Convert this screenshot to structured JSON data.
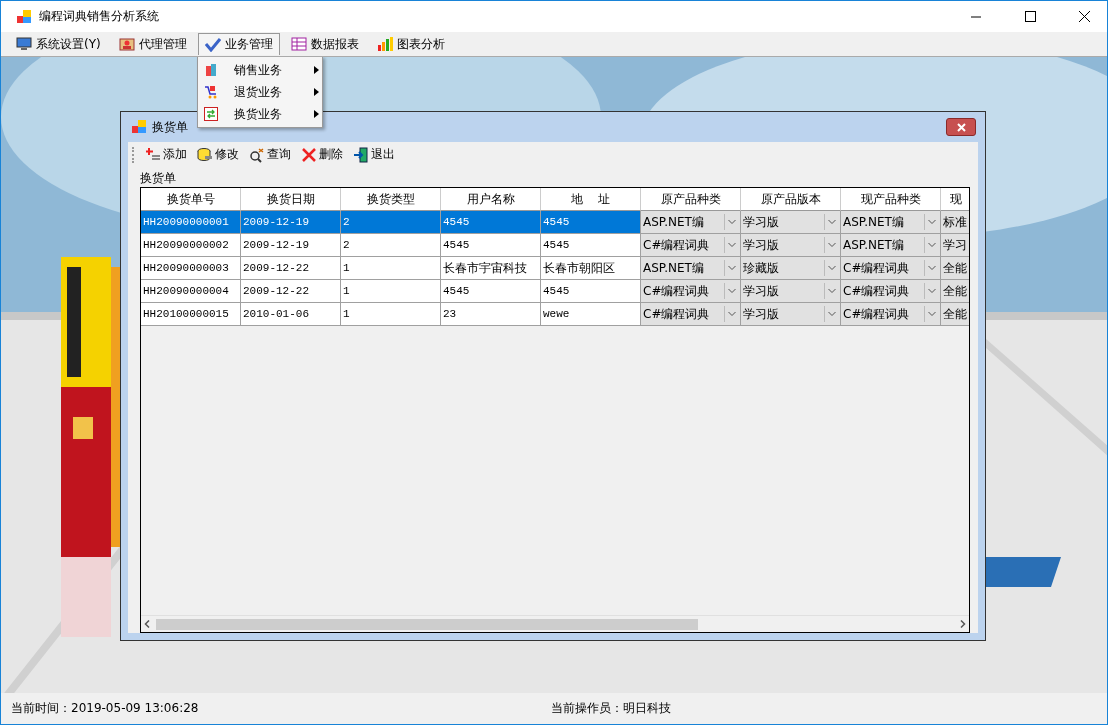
{
  "window": {
    "title": "编程词典销售分析系统"
  },
  "menu": [
    {
      "label": "系统设置(Y)",
      "selected": false
    },
    {
      "label": "代理管理",
      "selected": false
    },
    {
      "label": "业务管理",
      "selected": true
    },
    {
      "label": "数据报表",
      "selected": false
    },
    {
      "label": "图表分析",
      "selected": false
    }
  ],
  "submenu": [
    {
      "label": "销售业务"
    },
    {
      "label": "退货业务"
    },
    {
      "label": "换货业务"
    }
  ],
  "child_window": {
    "title": "换货单",
    "toolbar": [
      {
        "label": "添加"
      },
      {
        "label": "修改"
      },
      {
        "label": "查询"
      },
      {
        "label": "删除"
      },
      {
        "label": "退出"
      }
    ],
    "group_label": "换货单",
    "table": {
      "columns": [
        {
          "label": "换货单号",
          "kind": "text"
        },
        {
          "label": "换货日期",
          "kind": "text"
        },
        {
          "label": "换货类型",
          "kind": "text"
        },
        {
          "label": "用户名称",
          "kind": "text"
        },
        {
          "label": "地    址",
          "kind": "text"
        },
        {
          "label": "原产品种类",
          "kind": "combo"
        },
        {
          "label": "原产品版本",
          "kind": "combo"
        },
        {
          "label": "现产品种类",
          "kind": "combo"
        },
        {
          "label": "现",
          "kind": "combo"
        }
      ],
      "rows": [
        {
          "selected": true,
          "cells": [
            "HH20090000001",
            "2009-12-19",
            "2",
            "4545",
            "4545",
            "ASP.NET编",
            "学习版",
            "ASP.NET编",
            "标准"
          ]
        },
        {
          "selected": false,
          "cells": [
            "HH20090000002",
            "2009-12-19",
            "2",
            "4545",
            "4545",
            "C#编程词典",
            "学习版",
            "ASP.NET编",
            "学习"
          ]
        },
        {
          "selected": false,
          "cells": [
            "HH20090000003",
            "2009-12-22",
            "1",
            "长春市宇宙科技",
            "长春市朝阳区",
            "ASP.NET编",
            "珍藏版",
            "C#编程词典",
            "全能"
          ]
        },
        {
          "selected": false,
          "cells": [
            "HH20090000004",
            "2009-12-22",
            "1",
            "4545",
            "4545",
            "C#编程词典",
            "学习版",
            "C#编程词典",
            "全能"
          ]
        },
        {
          "selected": false,
          "cells": [
            "HH20100000015",
            "2010-01-06",
            "1",
            "23",
            "wewe",
            "C#编程词典",
            "学习版",
            "C#编程词典",
            "全能"
          ]
        }
      ]
    }
  },
  "status_bar": {
    "time": "当前时间：2019-05-09 13:06:28",
    "operator": "当前操作员：明日科技"
  }
}
